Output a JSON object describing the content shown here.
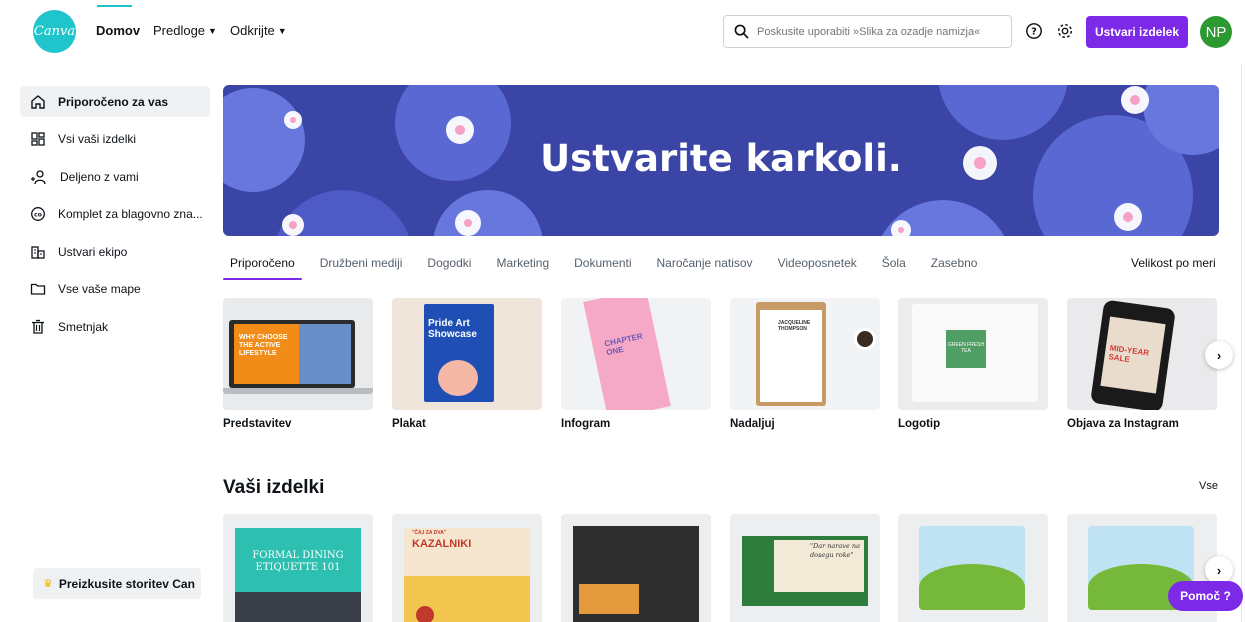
{
  "brand": {
    "logo_text": "Canva",
    "accent": "#7d2ae8",
    "teal": "#20c4cb"
  },
  "nav": {
    "home": "Domov",
    "templates": "Predloge",
    "discover": "Odkrijte"
  },
  "search": {
    "placeholder": "Poskusite uporabiti »Slika za ozadje namizja«"
  },
  "header": {
    "create_label": "Ustvari izdelek",
    "avatar_initials": "NP"
  },
  "sidebar": {
    "items": [
      {
        "label": "Priporočeno za vas",
        "icon": "home-icon"
      },
      {
        "label": "Vsi vaši izdelki",
        "icon": "grid-icon"
      },
      {
        "label": "Deljeno z vami",
        "icon": "shared-users-icon"
      },
      {
        "label": "Komplet za blagovno zna...",
        "icon": "brand-kit-icon"
      },
      {
        "label": "Ustvari ekipo",
        "icon": "team-building-icon"
      },
      {
        "label": "Vse vaše mape",
        "icon": "folder-icon"
      },
      {
        "label": "Smetnjak",
        "icon": "trash-icon"
      }
    ],
    "trial_label": "Preizkusite storitev Can"
  },
  "hero": {
    "title": "Ustvarite karkoli."
  },
  "tabs": [
    "Priporočeno",
    "Družbeni mediji",
    "Dogodki",
    "Marketing",
    "Dokumenti",
    "Naročanje natisov",
    "Videoposnetek",
    "Šola",
    "Zasebno"
  ],
  "custom_size": "Velikost po meri",
  "types": [
    {
      "label": "Predstavitev",
      "thumb_text": "WHY CHOOSE THE ACTIVE LIFESTYLE"
    },
    {
      "label": "Plakat",
      "thumb_text": "Pride Art Showcase"
    },
    {
      "label": "Infogram",
      "thumb_text": "CHAPTER ONE"
    },
    {
      "label": "Nadaljuj",
      "thumb_text": "JACQUELINE THOMPSON"
    },
    {
      "label": "Logotip",
      "thumb_text": "GREEN FRESH TEA"
    },
    {
      "label": "Objava za Instagram",
      "thumb_text": "MID-YEAR SALE"
    }
  ],
  "designs_section": {
    "title": "Vaši izdelki",
    "see_all": "Vse"
  },
  "designs": [
    {
      "line1": "FORMAL DINING",
      "line2": "ETIQUETTE 101"
    },
    {
      "line1": "\"ČAJ ZA DVA\"",
      "line2": "KAZALNIKI"
    },
    {
      "line1": "",
      "line2": ""
    },
    {
      "line1": "\"Dar narave na",
      "line2": "dosegu roke\""
    },
    {
      "line1": "",
      "line2": ""
    },
    {
      "line1": "",
      "line2": ""
    }
  ],
  "help": {
    "label": "Pomoč ?"
  }
}
